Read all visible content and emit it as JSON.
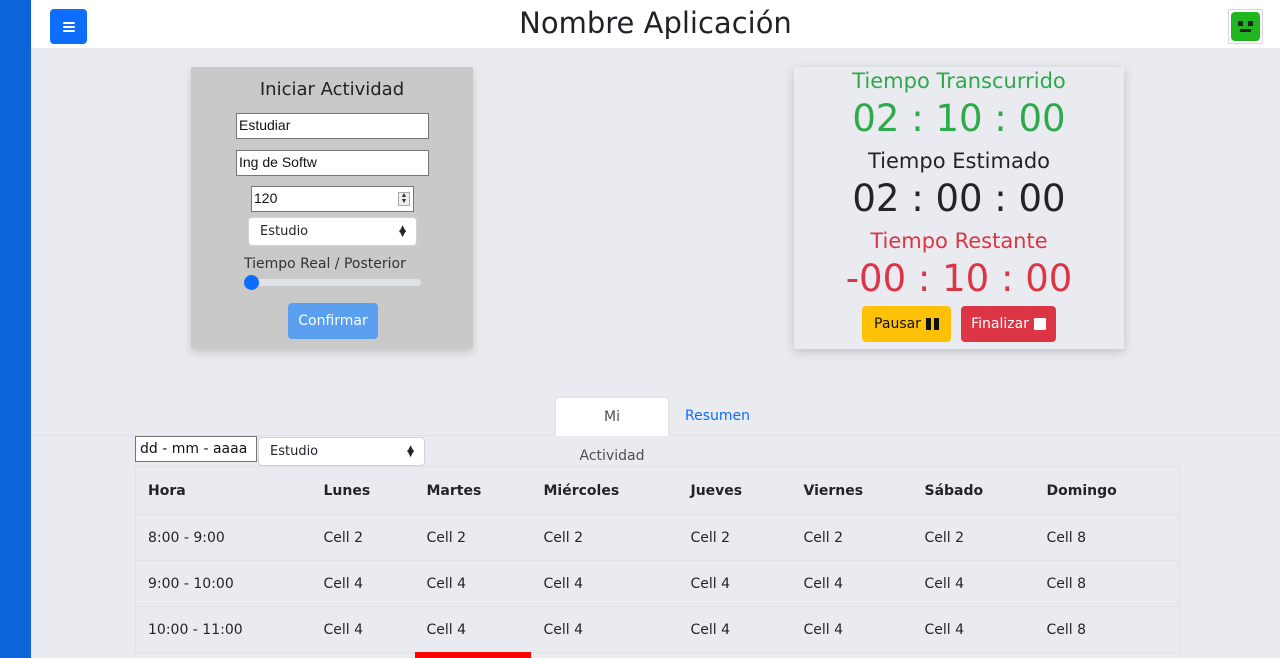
{
  "header": {
    "title": "Nombre Aplicación",
    "menu_icon": "hamburger-icon",
    "avatar_icon": "green-robot-avatar"
  },
  "start_form": {
    "title": "Iniciar Actividad",
    "activity_value": "Estudiar",
    "subject_value": "Ing de Softw",
    "minutes_value": "120",
    "category_selected": "Estudio",
    "slider_label": "Tiempo Real / Posterior",
    "slider_value": 0,
    "confirm_label": "Confirmar"
  },
  "timer": {
    "elapsed_label": "Tiempo Transcurrido",
    "elapsed_value": "02 : 10 : 00",
    "estimated_label": "Tiempo Estimado",
    "estimated_value": "02 : 00 : 00",
    "remaining_label": "Tiempo Restante",
    "remaining_value": "-00 : 10 : 00",
    "pause_label": "Pausar",
    "finish_label": "Finalizar",
    "colors": {
      "elapsed": "#2eaa4a",
      "remaining": "#dc3545",
      "pause": "#ffc107",
      "finish": "#dc3545"
    }
  },
  "tabs": [
    {
      "label": "Mi Actividad"
    },
    {
      "label": "Resumen"
    }
  ],
  "filters": {
    "date_value": "dd - mm - aaaa",
    "category_selected": "Estudio"
  },
  "table": {
    "headers": [
      "Hora",
      "Lunes",
      "Martes",
      "Miércoles",
      "Jueves",
      "Viernes",
      "Sábado",
      "Domingo"
    ],
    "rows": [
      [
        "8:00 - 9:00",
        "Cell 2",
        "Cell 2",
        "Cell 2",
        "Cell 2",
        "Cell 2",
        "Cell 2",
        "Cell 8"
      ],
      [
        "9:00 - 10:00",
        "Cell 4",
        "Cell 4",
        "Cell 4",
        "Cell 4",
        "Cell 4",
        "Cell 4",
        "Cell 8"
      ],
      [
        "10:00 - 11:00",
        "Cell 4",
        "Cell 4",
        "Cell 4",
        "Cell 4",
        "Cell 4",
        "Cell 4",
        "Cell 8"
      ]
    ]
  }
}
